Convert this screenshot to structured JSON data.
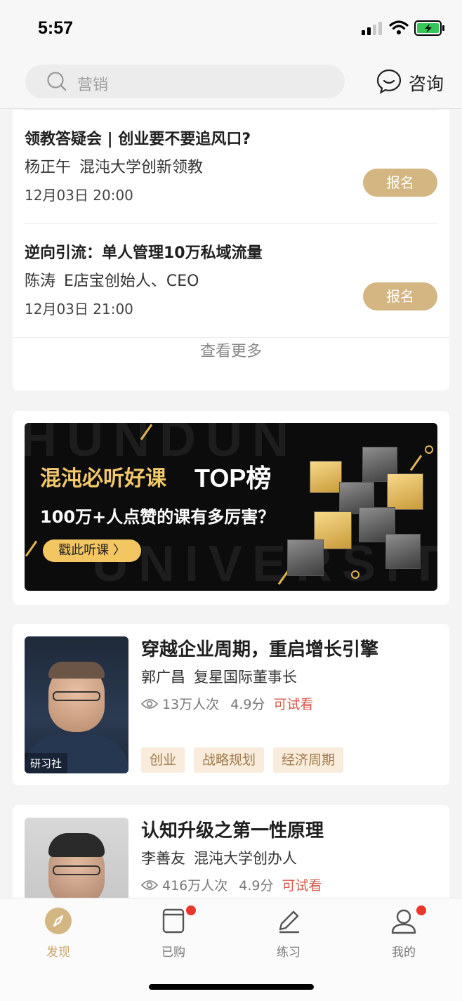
{
  "status_bar": {
    "time": "5:57"
  },
  "search": {
    "placeholder": "营销",
    "consult_label": "咨询"
  },
  "events": [
    {
      "title": "领教答疑会 | 创业要不要追风口?",
      "speaker": "杨正午",
      "speaker_title": "混沌大学创新领教",
      "time": "12月03日 20:00",
      "button": "报名"
    },
    {
      "title": "逆向引流：单人管理10万私域流量",
      "speaker": "陈涛",
      "speaker_title": "E店宝创始人、CEO",
      "time": "12月03日 21:00",
      "button": "报名"
    }
  ],
  "events_more": "查看更多",
  "banner": {
    "title": "混沌必听好课",
    "title_emphasis": "TOP榜",
    "subtitle": "100万+人点赞的课有多厉害？",
    "cta": "戳此听课 〉",
    "bg_line1": "HUNDUN",
    "bg_line2": "UNIVERSITY"
  },
  "courses": [
    {
      "title": "穿越企业周期，重启增长引擎",
      "teacher": "郭广昌",
      "teacher_title": "复星国际董事长",
      "views": "13万人次",
      "rating": "4.9分",
      "trial": "可试看",
      "badge": "研习社",
      "tags": [
        "创业",
        "战略规划",
        "经济周期"
      ]
    },
    {
      "title": "认知升级之第一性原理",
      "teacher": "李善友",
      "teacher_title": "混沌大学创办人",
      "views": "416万人次",
      "rating": "4.9分",
      "trial": "可试看"
    }
  ],
  "tabs": [
    {
      "label": "发现",
      "icon": "compass-icon",
      "active": true
    },
    {
      "label": "已购",
      "icon": "purchased-icon",
      "badge_dot": true
    },
    {
      "label": "练习",
      "icon": "pencil-icon"
    },
    {
      "label": "我的",
      "icon": "profile-icon",
      "badge_dot": true
    }
  ],
  "colors": {
    "accent": "#d4b683",
    "active_tab": "#c9a56b",
    "trial": "#d45a4a",
    "badge": "#e8382b",
    "banner_gold": "#f2c86a"
  }
}
